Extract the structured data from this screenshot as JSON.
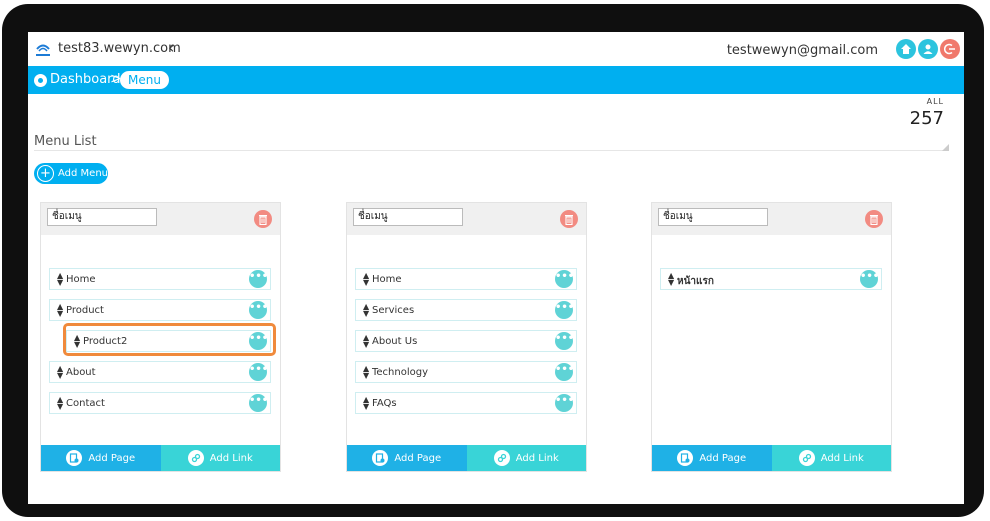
{
  "topbar": {
    "domain": "test83.wewyn.com",
    "email": "testwewyn@gmail.com"
  },
  "breadcrumb": {
    "dashboard": "Dashboard",
    "separator": ">",
    "current": "Menu"
  },
  "stats": {
    "label": "ALL",
    "count": "257"
  },
  "menu_list": {
    "title": "Menu List",
    "add_menu": "Add  Menu"
  },
  "cards": [
    {
      "name": "ชื่อเมนู",
      "items": [
        "Home",
        "Product",
        "Product2",
        "About",
        "Contact"
      ],
      "add_page": "Add Page",
      "add_link": "Add Link"
    },
    {
      "name": "ชื่อเมนู",
      "items": [
        "Home",
        "Services",
        "About Us",
        "Technology",
        "FAQs"
      ],
      "add_page": "Add Page",
      "add_link": "Add Link"
    },
    {
      "name": "ชื่อเมนู",
      "items": [
        "หน้าแรก"
      ],
      "add_page": "Add Page",
      "add_link": "Add Link"
    }
  ],
  "icons": {
    "sort": "sort-arrows-icon",
    "more": "more-dots-icon",
    "delete": "trash-icon",
    "home": "home-icon",
    "user": "user-icon",
    "logout": "logout-icon"
  },
  "colors": {
    "primary": "#00aff0",
    "teal": "#39d4d7",
    "danger": "#f28b82",
    "highlight": "#f08a3c"
  }
}
